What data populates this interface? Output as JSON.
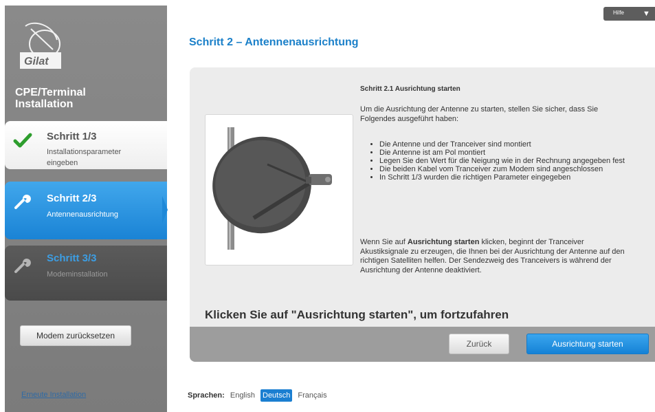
{
  "sidebar": {
    "logo_text": "Gilat",
    "app_title_line1": "CPE/Terminal",
    "app_title_line2": "Installation",
    "steps": [
      {
        "title": "Schritt 1/3",
        "subtitle_line1": "Installationsparameter",
        "subtitle_line2": "eingeben",
        "state": "completed",
        "icon": "check-icon"
      },
      {
        "title": "Schritt 2/3",
        "subtitle_line1": "Antennenausrichtung",
        "state": "active",
        "icon": "wrench-icon"
      },
      {
        "title": "Schritt 3/3",
        "subtitle_line1": "Modeminstallation",
        "state": "pending",
        "icon": "wrench-icon"
      }
    ],
    "reset_button": "Modem zurücksetzen",
    "reinstall_link": "Erneute Installation"
  },
  "help": {
    "label": "Hilfe",
    "icon": "triangle-down-icon"
  },
  "main": {
    "page_title": "Schritt 2 – Antennenausrichtung",
    "section_title": "Schritt 2.1 Ausrichtung starten",
    "intro": "Um die Ausrichtung der Antenne zu starten, stellen Sie sicher, dass Sie Folgendes ausgeführt haben:",
    "bullets": [
      "Die Antenne und der Tranceiver sind montiert",
      "Die Antenne ist am Pol montiert",
      "Legen Sie den Wert für die Neigung wie in der Rechnung angegeben fest",
      "Die beiden Kabel vom Tranceiver zum Modem sind angeschlossen",
      "In Schritt 1/3 wurden die richtigen Parameter eingegeben"
    ],
    "outro_prefix": "Wenn Sie auf ",
    "outro_bold": "Ausrichtung starten",
    "outro_suffix": " klicken, beginnt der Tranceiver Akustiksignale zu erzeugen, die Ihnen bei der Ausrichtung der Antenne auf den richtigen Satelliten helfen. Der Sendezweig des Tranceivers is während der Ausrichtung der Antenne deaktiviert.",
    "cta": "Klicken Sie auf \"Ausrichtung starten\", um fortzufahren",
    "back_button": "Zurück",
    "start_button": "Ausrichtung starten"
  },
  "languages": {
    "label": "Sprachen:",
    "options": [
      "English",
      "Deutsch",
      "Français"
    ],
    "selected": "Deutsch"
  },
  "colors": {
    "accent_blue": "#1b80c9",
    "sidebar_gray": "#808080",
    "check_green": "#2e9e2e"
  }
}
